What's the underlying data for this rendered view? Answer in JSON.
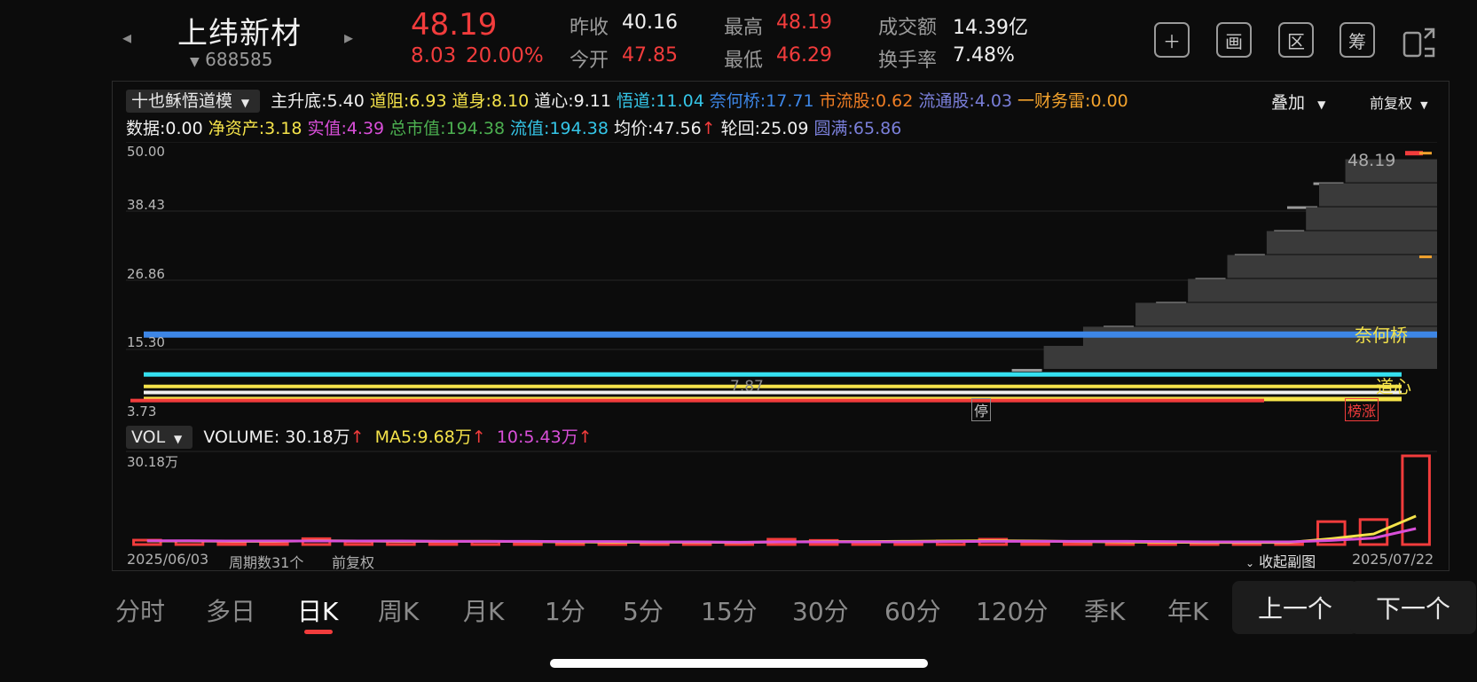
{
  "header": {
    "name": "上纬新材",
    "code": "688585",
    "price": "48.19",
    "change": "8.03",
    "change_pct": "20.00%",
    "quote": {
      "prev_close_label": "昨收",
      "prev_close": "40.16",
      "open_label": "今开",
      "open": "47.85",
      "high_label": "最高",
      "high": "48.19",
      "low_label": "最低",
      "low": "46.29",
      "amount_label": "成交额",
      "amount": "14.39亿",
      "turnover_label": "换手率",
      "turnover": "7.48%"
    },
    "icons": [
      "plus-icon",
      "draw-icon",
      "range-icon",
      "chip-icon",
      "switch-layout-icon"
    ],
    "icon_glyphs": {
      "draw": "画",
      "range": "区",
      "chip": "筹"
    }
  },
  "indicators": {
    "selector": "十也稣悟道模",
    "row1": [
      {
        "label": "主升底:",
        "value": "5.40",
        "color": "#f0f0f0"
      },
      {
        "label": "道阻:",
        "value": "6.93",
        "color": "#f5e34a"
      },
      {
        "label": "道身:",
        "value": "8.10",
        "color": "#f5e34a"
      },
      {
        "label": "道心:",
        "value": "9.11",
        "color": "#f0f0f0"
      },
      {
        "label": "悟道:",
        "value": "11.04",
        "color": "#35c6e8"
      },
      {
        "label": "奈何桥:",
        "value": "17.71",
        "color": "#3d86e6"
      },
      {
        "label": "市流股:",
        "value": "0.62",
        "color": "#ee7d24"
      },
      {
        "label": "流通股:",
        "value": "4.03",
        "color": "#7a7fd9"
      },
      {
        "label": "一财务雷:",
        "value": "0.00",
        "color": "#f3a32d"
      }
    ],
    "row2": [
      {
        "label": "数据:",
        "value": "0.00",
        "color": "#f0f0f0"
      },
      {
        "label": "净资产:",
        "value": "3.18",
        "color": "#f5e34a"
      },
      {
        "label": "实值:",
        "value": "4.39",
        "color": "#d94fd9"
      },
      {
        "label": "总市值:",
        "value": "194.38",
        "color": "#4caf50"
      },
      {
        "label": "流值:",
        "value": "194.38",
        "color": "#35c6e8"
      },
      {
        "label": "均价:",
        "value": "47.56",
        "color": "#f0f0f0"
      },
      {
        "label": "轮回:",
        "value": "25.09",
        "color": "#f0f0f0"
      },
      {
        "label": "圆满:",
        "value": "65.86",
        "color": "#7a7fd9"
      }
    ],
    "overlay": "叠加",
    "adjust": "前复权",
    "arrow": "↑"
  },
  "kline": {
    "y_labels": [
      "50.00",
      "38.43",
      "26.86",
      "15.30",
      "3.73"
    ],
    "last_label": "48.19",
    "mid_label": "7.87",
    "line_labels": {
      "naihe": "奈何桥",
      "daoxin": "道心"
    },
    "markers": {
      "halt": "停",
      "limit": "榜涨"
    }
  },
  "volume": {
    "selector": "VOL",
    "volume_label": "VOLUME:",
    "volume": "30.18万",
    "ma5_label": "MA5:",
    "ma5": "9.68万",
    "ma10_label": "10:",
    "ma10": "5.43万",
    "arrow": "↑",
    "y_top": "30.18万"
  },
  "footer": {
    "start_date": "2025/06/03",
    "periods": "周期数31个",
    "adjust": "前复权",
    "collapse": "收起副图",
    "end_date": "2025/07/22"
  },
  "tabs": [
    "分时",
    "多日",
    "日K",
    "周K",
    "月K",
    "1分",
    "5分",
    "15分",
    "30分",
    "60分",
    "120分",
    "季K",
    "年K"
  ],
  "active_tab": "日K",
  "nav": {
    "prev": "上一个",
    "next": "下一个"
  },
  "chart_data": [
    {
      "type": "bar",
      "title": "",
      "xlabel": "",
      "ylabel": "",
      "x": [
        "2025/06/03",
        "2025/07/22"
      ],
      "ylim": [
        3.73,
        50.0
      ],
      "series": [
        {
          "name": "奈何桥",
          "values": [
            17.71
          ]
        },
        {
          "name": "道心",
          "values": [
            9.11
          ]
        }
      ],
      "last_close": 48.19,
      "volume_profile_levels": [
        46.5,
        42.5,
        38.5,
        34.5,
        30.5,
        26.5,
        22.5,
        18.5,
        15.3
      ],
      "volume_profile_widths": [
        0.07,
        0.09,
        0.1,
        0.13,
        0.16,
        0.19,
        0.23,
        0.27,
        0.3
      ]
    },
    {
      "type": "bar",
      "title": "",
      "ylim": [
        0,
        30.18
      ],
      "categories_count": 31,
      "values": [
        1.5,
        1.2,
        0.8,
        0.9,
        2.0,
        1.0,
        1.0,
        0.9,
        1.0,
        0.7,
        0.7,
        0.8,
        0.7,
        0.8,
        0.6,
        1.8,
        1.4,
        0.7,
        0.6,
        1.2,
        1.8,
        0.8,
        0.8,
        0.7,
        0.6,
        0.6,
        0.7,
        0.6,
        7.8,
        8.5,
        30.18
      ],
      "up": [
        false,
        false,
        false,
        false,
        false,
        false,
        false,
        false,
        false,
        false,
        false,
        false,
        false,
        false,
        false,
        false,
        false,
        false,
        false,
        false,
        false,
        false,
        false,
        false,
        false,
        false,
        false,
        false,
        false,
        false,
        false
      ],
      "series": [
        {
          "name": "MA5",
          "values": [
            1.2,
            1.2,
            1.1,
            1.1,
            1.3,
            1.2,
            1.1,
            1.1,
            1.1,
            1.0,
            0.9,
            0.8,
            0.8,
            0.8,
            0.7,
            0.9,
            1.0,
            1.0,
            1.1,
            1.2,
            1.3,
            1.2,
            1.0,
            0.9,
            0.8,
            0.7,
            0.7,
            0.7,
            2.0,
            3.6,
            9.68
          ]
        },
        {
          "name": "10",
          "values": [
            1.3,
            1.3,
            1.2,
            1.2,
            1.2,
            1.2,
            1.2,
            1.1,
            1.1,
            1.1,
            1.0,
            1.0,
            0.9,
            0.9,
            0.8,
            0.9,
            0.9,
            0.9,
            0.9,
            1.0,
            1.1,
            1.1,
            1.1,
            1.1,
            1.0,
            0.9,
            0.9,
            0.9,
            1.4,
            2.2,
            5.43
          ]
        }
      ]
    }
  ]
}
